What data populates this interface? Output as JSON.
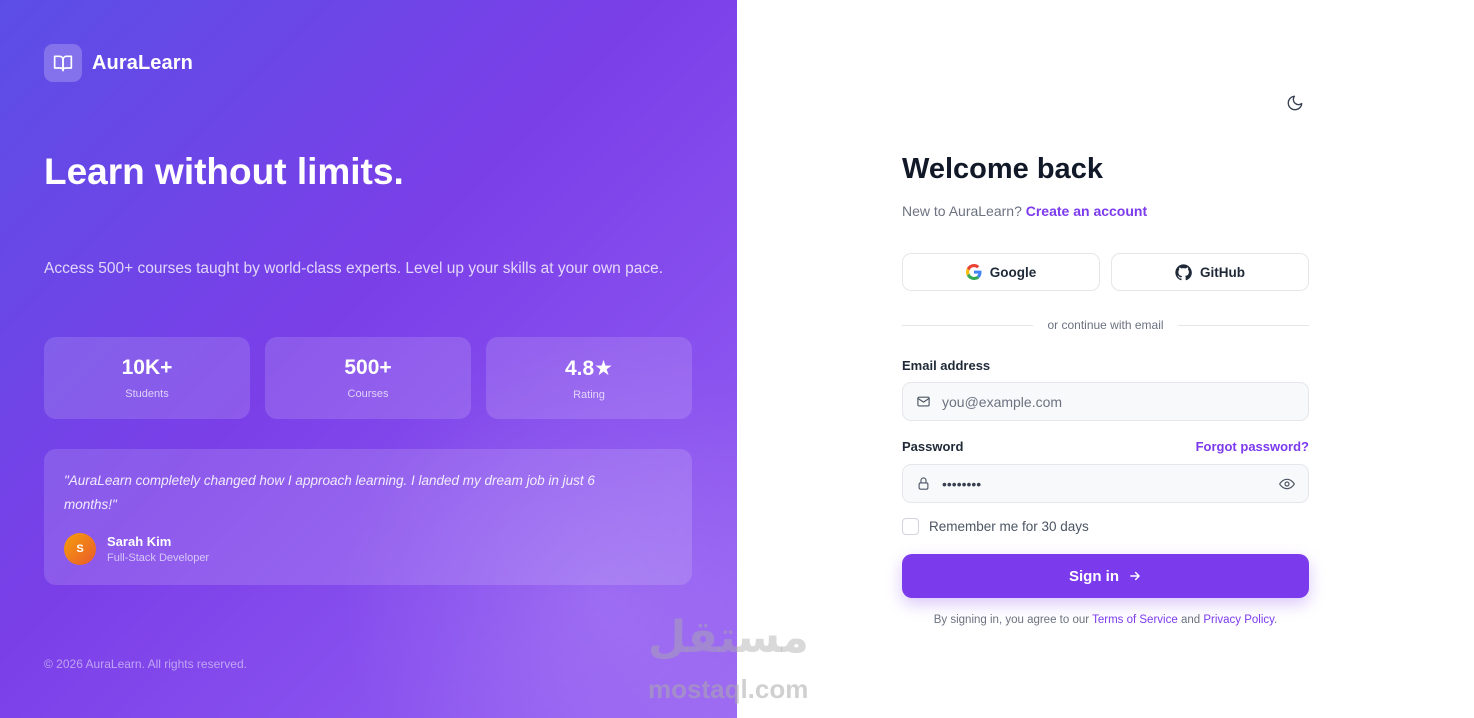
{
  "brand": {
    "name": "AuraLearn",
    "logo_icon": "book-open-icon"
  },
  "hero": {
    "title": "Learn without limits.",
    "subtitle": "Access 500+ courses taught by world-class experts. Level up your skills at your own pace."
  },
  "stats": [
    {
      "value": "10K+",
      "label": "Students"
    },
    {
      "value": "500+",
      "label": "Courses"
    },
    {
      "value": "4.8★",
      "label": "Rating"
    }
  ],
  "testimonial": {
    "quote": "\"AuraLearn completely changed how I approach learning. I landed my dream job in just 6 months!\"",
    "author_initial": "S",
    "author_name": "Sarah Kim",
    "author_role": "Full-Stack Developer"
  },
  "footer": {
    "copyright": "© 2026 AuraLearn. All rights reserved."
  },
  "auth": {
    "theme_toggle_icon": "moon-icon",
    "title": "Welcome back",
    "signup_prompt": "New to AuraLearn?",
    "signup_link": "Create an account",
    "social": {
      "google": "Google",
      "github": "GitHub"
    },
    "divider": "or continue with email",
    "email": {
      "label": "Email address",
      "placeholder": "you@example.com",
      "value": ""
    },
    "password": {
      "label": "Password",
      "value": "••••••••",
      "forgot": "Forgot password?"
    },
    "remember": {
      "label": "Remember me for 30 days",
      "checked": false
    },
    "submit": "Sign in",
    "terms": {
      "prefix": "By signing in, you agree to our",
      "tos": "Terms of Service",
      "and": "and",
      "privacy": "Privacy Policy",
      "suffix": "."
    }
  },
  "watermark": {
    "arabic": "مستقل",
    "latin": "mostaql.com"
  },
  "colors": {
    "accent": "#7c3aed",
    "gradient_start": "#5b4ee6",
    "gradient_end": "#9a66f2"
  }
}
